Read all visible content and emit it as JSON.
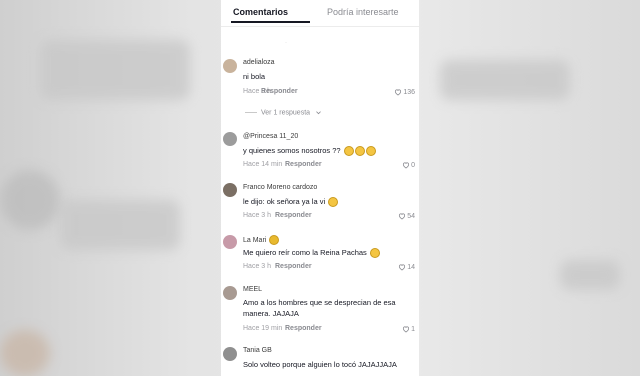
{
  "tabs": {
    "comments": "Comentarios",
    "suggested": "Podría interesarte"
  },
  "comments": [
    {
      "username": "adelialoza",
      "text": "ni bola",
      "time": "Hace 9 h",
      "reply": "Responder",
      "likes": "136",
      "view_replies": "Ver 1 respuesta"
    },
    {
      "username": "@Princesa 11_20",
      "text": "y quienes somos nosotros ??",
      "time": "Hace 14 min",
      "reply": "Responder",
      "likes": "0"
    },
    {
      "username": "Franco Moreno cardozo",
      "text": "le dijo: ok señora ya la vi",
      "time": "Hace 3 h",
      "reply": "Responder",
      "likes": "54"
    },
    {
      "username": "La Mari",
      "text": "Me quiero reír como la Reina Pachas",
      "time": "Hace 3 h",
      "reply": "Responder",
      "likes": "14"
    },
    {
      "username": "MEEL",
      "text": "Amo a los hombres que se desprecian de esa manera. JAJAJA",
      "time": "Hace 19 min",
      "reply": "Responder",
      "likes": "1"
    },
    {
      "username": "Tania GB",
      "text": "Solo volteo porque alguien lo tocó JAJAJJAJA"
    }
  ],
  "colors": {
    "accent": "#161823",
    "muted": "#8a8b91"
  },
  "icons": {
    "like": "heart-outline-icon",
    "expand": "chevron-down-icon"
  }
}
